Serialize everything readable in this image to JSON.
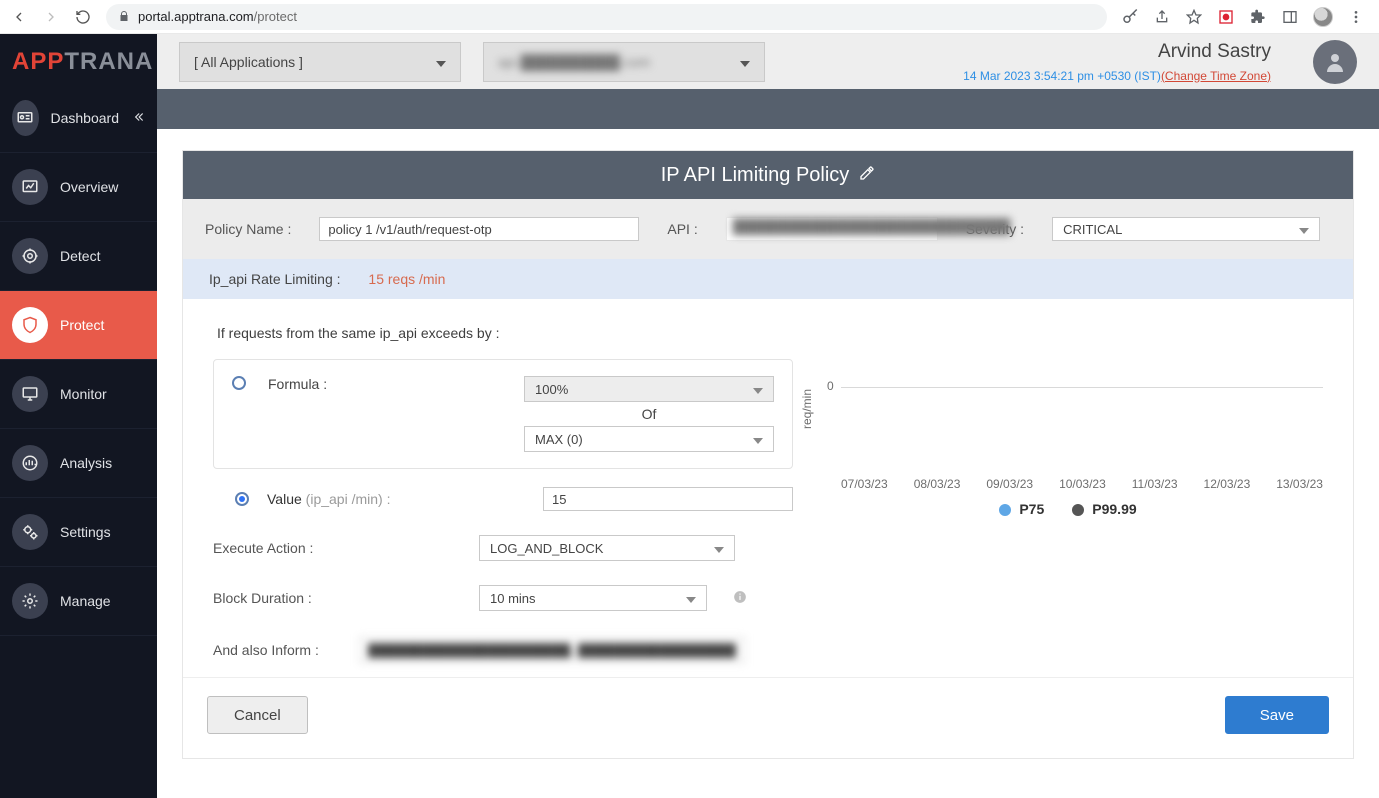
{
  "browser": {
    "url_host": "portal.apptrana.com",
    "url_path": "/protect"
  },
  "brand": {
    "part1": "APP",
    "part2": "TRANA"
  },
  "sidebar": {
    "items": [
      {
        "label": "Dashboard"
      },
      {
        "label": "Overview"
      },
      {
        "label": "Detect"
      },
      {
        "label": "Protect"
      },
      {
        "label": "Monitor"
      },
      {
        "label": "Analysis"
      },
      {
        "label": "Settings"
      },
      {
        "label": "Manage"
      }
    ]
  },
  "topbar": {
    "app_selector": "[ All Applications ]",
    "site_selector": "api.██████████.com",
    "user_name": "Arvind Sastry",
    "timestamp": "14 Mar 2023 3:54:21 pm +0530 (IST)",
    "change_tz": "(Change Time Zone)"
  },
  "panel": {
    "title": "IP API Limiting Policy",
    "policy_name_label": "Policy Name :",
    "policy_name": "policy 1 /v1/auth/request-otp",
    "api_label": "API :",
    "api_value": "████████████████████████████",
    "severity_label": "Severity :",
    "severity_value": "CRITICAL",
    "rate_label": "Ip_api Rate Limiting :",
    "rate_value": "15 reqs /min",
    "cond_text": "If requests from the same ip_api exceeds by :",
    "formula_label": "Formula :",
    "formula_pct": "100%",
    "of_word": "Of",
    "formula_agg": "MAX (0)",
    "value_label": "Value",
    "value_hint": "(ip_api /min) :",
    "value": "15",
    "exec_label": "Execute Action :",
    "exec_value": "LOG_AND_BLOCK",
    "block_dur_label": "Block Duration :",
    "block_dur_value": "10 mins",
    "inform_label": "And also Inform :",
    "inform_value": "██████████████████████, ████████████████████",
    "cancel": "Cancel",
    "save": "Save"
  },
  "chart_data": {
    "type": "line",
    "title": "",
    "xlabel": "",
    "ylabel": "req/min",
    "ylim": [
      0,
      0
    ],
    "yticks": [
      0
    ],
    "categories": [
      "07/03/23",
      "08/03/23",
      "09/03/23",
      "10/03/23",
      "11/03/23",
      "12/03/23",
      "13/03/23"
    ],
    "series": [
      {
        "name": "P75",
        "color": "#5fa7e6",
        "values": [
          0,
          0,
          0,
          0,
          0,
          0,
          0
        ]
      },
      {
        "name": "P99.99",
        "color": "#555555",
        "values": [
          0,
          0,
          0,
          0,
          0,
          0,
          0
        ]
      }
    ]
  }
}
